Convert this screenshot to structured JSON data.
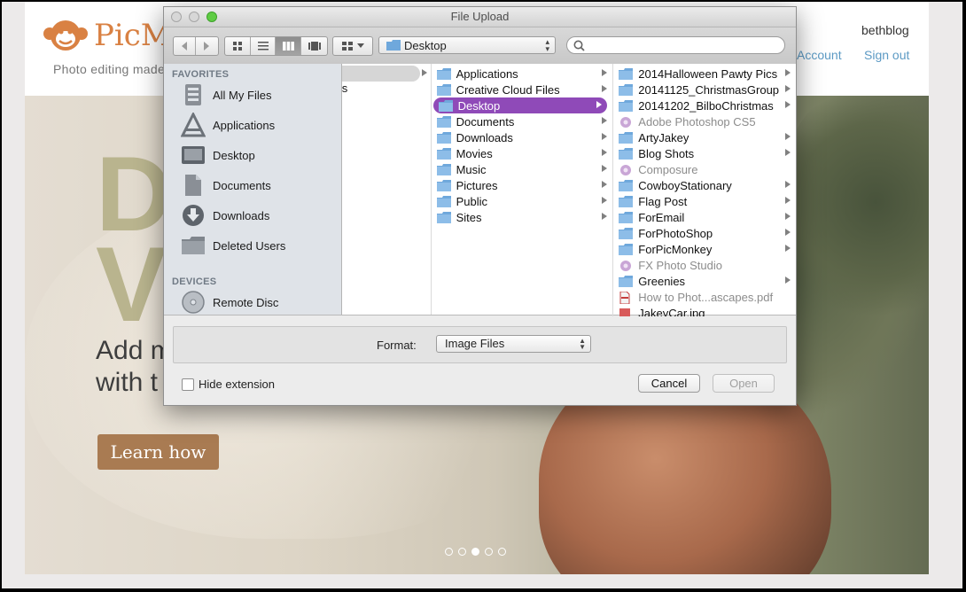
{
  "site": {
    "logo_text": "PicM",
    "tagline": "Photo editing made",
    "username": "bethblog",
    "nav": {
      "account": "Account",
      "signout": "Sign out"
    }
  },
  "hero": {
    "headline": "D",
    "headline2": "V",
    "subline1": "Add m",
    "subline2": "with t",
    "cta": "Learn how",
    "carousel": {
      "count": 5,
      "active_index": 2
    }
  },
  "dialog": {
    "title": "File Upload",
    "location": "Desktop",
    "search": {
      "value": "",
      "placeholder": ""
    },
    "sidebar": {
      "favorites_header": "FAVORITES",
      "favorites": [
        {
          "label": "All My Files",
          "icon": "all-files-icon"
        },
        {
          "label": "Applications",
          "icon": "applications-icon"
        },
        {
          "label": "Desktop",
          "icon": "desktop-icon"
        },
        {
          "label": "Documents",
          "icon": "documents-icon"
        },
        {
          "label": "Downloads",
          "icon": "downloads-icon"
        },
        {
          "label": "Deleted Users",
          "icon": "folder-icon"
        }
      ],
      "devices_header": "DEVICES",
      "devices": [
        {
          "label": "Remote Disc",
          "icon": "disc-icon"
        }
      ]
    },
    "column1": {
      "partial_text": "s"
    },
    "column2": [
      {
        "label": "Applications",
        "chevron": true
      },
      {
        "label": "Creative Cloud Files",
        "chevron": true
      },
      {
        "label": "Desktop",
        "chevron": true,
        "selected": true
      },
      {
        "label": "Documents",
        "chevron": true
      },
      {
        "label": "Downloads",
        "chevron": true
      },
      {
        "label": "Movies",
        "chevron": true
      },
      {
        "label": "Music",
        "chevron": true
      },
      {
        "label": "Pictures",
        "chevron": true
      },
      {
        "label": "Public",
        "chevron": true
      },
      {
        "label": "Sites",
        "chevron": true
      }
    ],
    "column3": [
      {
        "label": "2014Halloween Pawty Pics",
        "chevron": true,
        "kind": "folder"
      },
      {
        "label": "20141125_ChristmasGroup",
        "chevron": true,
        "kind": "folder"
      },
      {
        "label": "20141202_BilboChristmas",
        "chevron": true,
        "kind": "folder"
      },
      {
        "label": "Adobe Photoshop CS5",
        "chevron": false,
        "kind": "app",
        "dim": true
      },
      {
        "label": "ArtyJakey",
        "chevron": true,
        "kind": "folder"
      },
      {
        "label": "Blog Shots",
        "chevron": true,
        "kind": "folder"
      },
      {
        "label": "Composure",
        "chevron": false,
        "kind": "app",
        "dim": true
      },
      {
        "label": "CowboyStationary",
        "chevron": true,
        "kind": "folder"
      },
      {
        "label": "Flag Post",
        "chevron": true,
        "kind": "folder"
      },
      {
        "label": "ForEmail",
        "chevron": true,
        "kind": "folder"
      },
      {
        "label": "ForPhotoShop",
        "chevron": true,
        "kind": "folder"
      },
      {
        "label": "ForPicMonkey",
        "chevron": true,
        "kind": "folder"
      },
      {
        "label": "FX Photo Studio",
        "chevron": false,
        "kind": "app",
        "dim": true
      },
      {
        "label": "Greenies",
        "chevron": true,
        "kind": "folder"
      },
      {
        "label": "How to Phot...ascapes.pdf",
        "chevron": false,
        "kind": "pdf",
        "dim": true
      },
      {
        "label": "JakeyCar.jpg",
        "chevron": false,
        "kind": "image"
      }
    ],
    "format": {
      "label": "Format:",
      "value": "Image Files"
    },
    "hide_extension": {
      "label": "Hide extension",
      "checked": false
    },
    "buttons": {
      "cancel": "Cancel",
      "open": "Open"
    }
  },
  "colors": {
    "selection": "#8f4ab8",
    "link": "#5c9ac4",
    "logo": "#d98143",
    "cta": "#a97b52"
  }
}
